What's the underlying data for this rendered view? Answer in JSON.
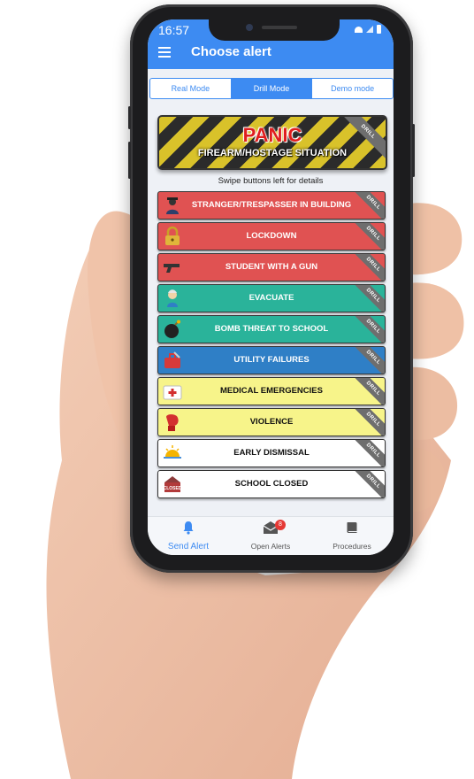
{
  "status_bar": {
    "time": "16:57"
  },
  "app_bar": {
    "title": "Choose alert"
  },
  "modes": [
    {
      "label": "Real Mode",
      "active": false
    },
    {
      "label": "Drill Mode",
      "active": true
    },
    {
      "label": "Demo mode",
      "active": false
    }
  ],
  "panic": {
    "title": "PANIC",
    "subtitle": "FIREARM/HOSTAGE SITUATION",
    "ribbon": "DRILL"
  },
  "hint": "Swipe buttons left for details",
  "alerts": [
    {
      "label": "STRANGER/TRESPASSER IN BUILDING",
      "ribbon": "DRILL",
      "color": "#e05252",
      "text_color": "#ffffff",
      "icon": "stranger-icon"
    },
    {
      "label": "LOCKDOWN",
      "ribbon": "DRILL",
      "color": "#e05252",
      "text_color": "#ffffff",
      "icon": "padlock-icon"
    },
    {
      "label": "STUDENT WITH A GUN",
      "ribbon": "DRILL",
      "color": "#e05252",
      "text_color": "#ffffff",
      "icon": "gun-icon"
    },
    {
      "label": "EVACUATE",
      "ribbon": "DRILL",
      "color": "#2ab39a",
      "text_color": "#ffffff",
      "icon": "evacuate-icon"
    },
    {
      "label": "BOMB THREAT TO SCHOOL",
      "ribbon": "DRILL",
      "color": "#2ab39a",
      "text_color": "#ffffff",
      "icon": "bomb-icon"
    },
    {
      "label": "UTILITY FAILURES",
      "ribbon": "DRILL",
      "color": "#2f7fc6",
      "text_color": "#ffffff",
      "icon": "toolbox-icon"
    },
    {
      "label": "MEDICAL EMERGENCIES",
      "ribbon": "DRILL",
      "color": "#f7f48a",
      "text_color": "#111111",
      "icon": "first-aid-icon"
    },
    {
      "label": "VIOLENCE",
      "ribbon": "DRILL",
      "color": "#f7f48a",
      "text_color": "#111111",
      "icon": "boxing-glove-icon"
    },
    {
      "label": "EARLY DISMISSAL",
      "ribbon": "DRILL",
      "color": "#ffffff",
      "text_color": "#111111",
      "icon": "sunset-icon"
    },
    {
      "label": "SCHOOL CLOSED",
      "ribbon": "DRILL",
      "color": "#ffffff",
      "text_color": "#111111",
      "icon": "closed-sign-icon"
    }
  ],
  "tabs": [
    {
      "label": "Send Alert",
      "icon": "bell-icon",
      "active": true
    },
    {
      "label": "Open Alerts",
      "icon": "envelope-icon",
      "badge": "8",
      "active": false
    },
    {
      "label": "Procedures",
      "icon": "book-icon",
      "active": false
    }
  ],
  "colors": {
    "accent": "#3d8bf2",
    "hazard_yellow": "#d9c22a",
    "panic_red": "#e01e1e"
  }
}
